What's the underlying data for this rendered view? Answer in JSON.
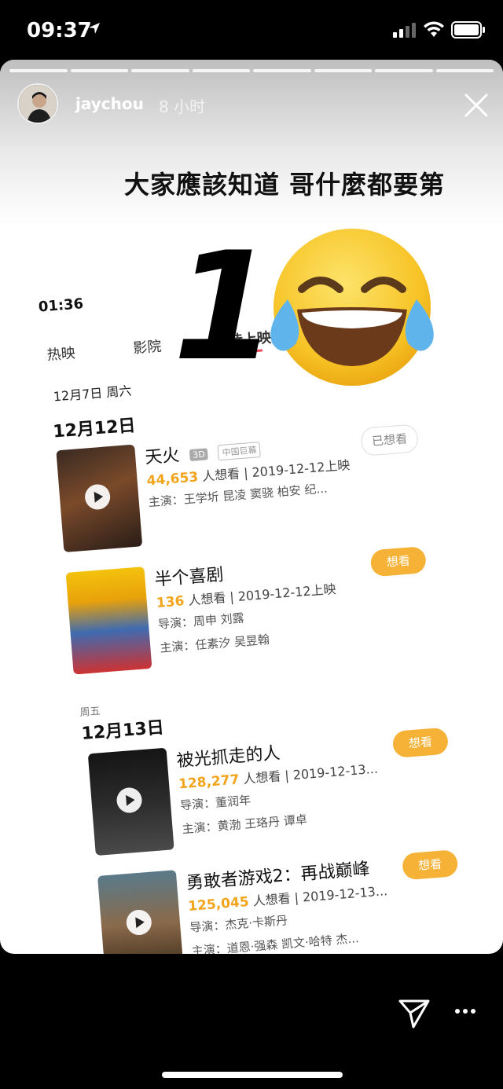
{
  "status_bar": {
    "time": "09:37"
  },
  "story": {
    "username": "jaychou",
    "time_ago": "8 小时",
    "caption": "大家應該知道 哥什麼都要第",
    "overlay_big_number": "1"
  },
  "phone_screenshot": {
    "time": "01:36",
    "tabs": [
      "热映",
      "影院",
      "待上映"
    ],
    "current_date": "12月7日 周六",
    "sections": [
      {
        "weekday": "",
        "date": "12月12日",
        "movies": [
          {
            "title": "天火",
            "tags": [
              "3D",
              "中国巨幕"
            ],
            "want_count": "44,653",
            "want_suffix": "人想看",
            "release": "2019-12-12上映",
            "line2": "主演：王学圻 昆凌 窦骁 柏安 纪...",
            "line3": "",
            "button": "已想看"
          },
          {
            "title": "半个喜剧",
            "tags": [],
            "want_count": "136",
            "want_suffix": "人想看",
            "release": "2019-12-12上映",
            "line2": "导演：周申 刘露",
            "line3": "主演：任素汐 吴昱翰",
            "button": "想看"
          }
        ]
      },
      {
        "weekday": "周五",
        "date": "12月13日",
        "movies": [
          {
            "title": "被光抓走的人",
            "tags": [],
            "want_count": "128,277",
            "want_suffix": "人想看",
            "release": "2019-12-13...",
            "line2": "导演：董润年",
            "line3": "主演：黄渤 王珞丹 谭卓",
            "button": "想看"
          },
          {
            "title": "勇敢者游戏2：再战巅峰",
            "tags": [],
            "want_count": "125,045",
            "want_suffix": "人想看",
            "release": "2019-12-13...",
            "line2": "导演：杰克·卡斯丹",
            "line3": "主演：道恩·强森 凯文·哈特 杰...",
            "button": "想看"
          }
        ]
      }
    ]
  },
  "icons": [
    "location-arrow-icon",
    "cellular-signal-icon",
    "wifi-icon",
    "battery-icon",
    "close-icon",
    "play-icon",
    "send-icon",
    "more-icon",
    "tears-of-joy-emoji"
  ],
  "colors": {
    "accent_orange": "#f5b236",
    "tab_underline": "#e8485a"
  }
}
